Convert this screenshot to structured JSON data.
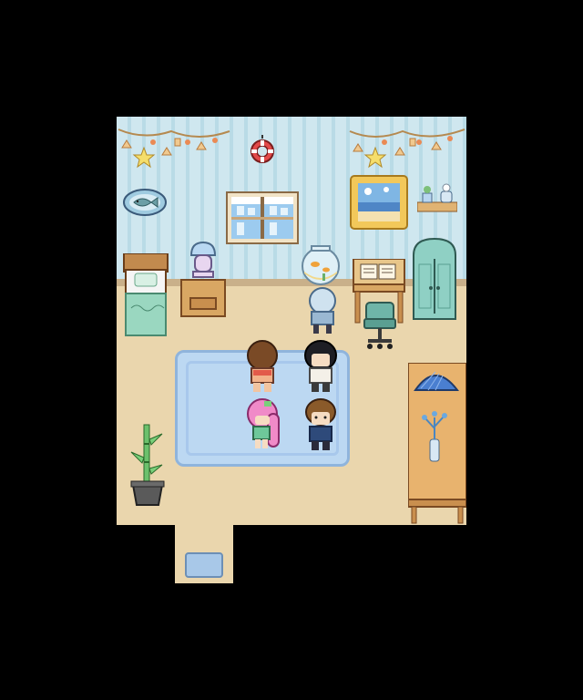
{
  "scene": {
    "name": "bedroom",
    "colors": {
      "background": "#000000",
      "floor": "#ead6ad",
      "wall": "#cfe7ef",
      "rug": "#bcd8f2"
    }
  },
  "objects": [
    {
      "name": "bunting-left",
      "icon": "garland-stars-shells"
    },
    {
      "name": "bunting-right",
      "icon": "garland-stars-shells"
    },
    {
      "name": "lifebuoy",
      "icon": "lifebuoy-icon"
    },
    {
      "name": "fish-plate",
      "icon": "fish-icon"
    },
    {
      "name": "window",
      "icon": "window-icon"
    },
    {
      "name": "beach-painting",
      "icon": "painting-icon"
    },
    {
      "name": "wall-shelf",
      "icon": "plant-shelf-icon"
    },
    {
      "name": "bed",
      "icon": "bed-icon"
    },
    {
      "name": "nightstand",
      "icon": "nightstand-icon"
    },
    {
      "name": "lamp",
      "icon": "lamp-icon"
    },
    {
      "name": "fishbowl",
      "icon": "fishbowl-icon"
    },
    {
      "name": "desk",
      "icon": "desk-icon"
    },
    {
      "name": "desk-chair",
      "icon": "chair-icon"
    },
    {
      "name": "cabinet",
      "icon": "cabinet-icon"
    },
    {
      "name": "rug",
      "icon": "rug-icon"
    },
    {
      "name": "side-table",
      "icon": "table-icon"
    },
    {
      "name": "potted-bamboo",
      "icon": "plant-icon"
    },
    {
      "name": "doormat",
      "icon": "doormat-icon"
    }
  ],
  "characters": [
    {
      "name": "brown-hair-girl",
      "facing": "up"
    },
    {
      "name": "black-hair-boy",
      "facing": "down"
    },
    {
      "name": "pink-hair-girl",
      "facing": "down"
    },
    {
      "name": "brown-hair-boy",
      "facing": "down"
    },
    {
      "name": "blue-hair-person",
      "facing": "up"
    }
  ]
}
